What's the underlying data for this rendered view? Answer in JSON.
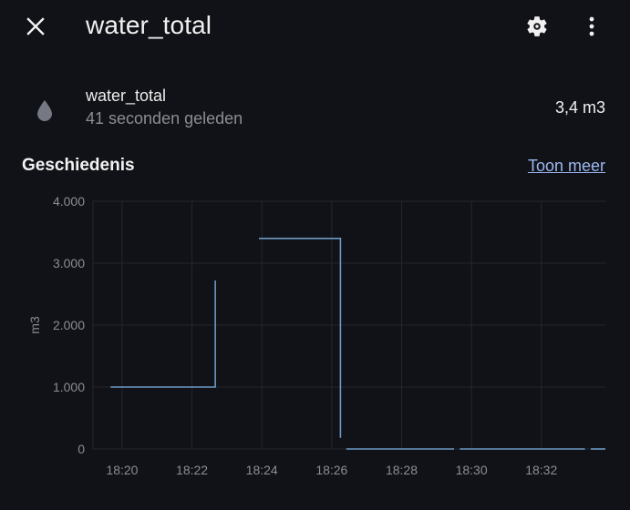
{
  "header": {
    "title": "water_total",
    "close_icon": "close-icon",
    "settings_icon": "gear-icon",
    "menu_icon": "dots-vertical-icon"
  },
  "entity": {
    "icon": "water-drop-icon",
    "name": "water_total",
    "last_changed": "41 seconden geleden",
    "state": "3,4 m3"
  },
  "history": {
    "title": "Geschiedenis",
    "show_more": "Toon meer"
  },
  "colors": {
    "background": "#111217",
    "accent_link": "#9ab8f0",
    "line": "#6e9ac4"
  },
  "chart_data": {
    "type": "line",
    "ylabel": "m3",
    "ylim": [
      0,
      4000
    ],
    "y_ticks": [
      "0",
      "1.000",
      "2.000",
      "3.000",
      "4.000"
    ],
    "x_ticks": [
      "18:20",
      "18:22",
      "18:24",
      "18:26",
      "18:28",
      "18:30",
      "18:32"
    ],
    "grid": true,
    "series": [
      {
        "segments": [
          [
            [
              "18:19:40",
              1000
            ],
            [
              "18:22:40",
              1000
            ],
            [
              "18:22:40",
              2720
            ]
          ],
          [
            [
              "18:23:55",
              3400
            ],
            [
              "18:26:15",
              3400
            ],
            [
              "18:26:15",
              180
            ]
          ],
          [
            [
              "18:26:25",
              0
            ],
            [
              "18:29:30",
              0
            ]
          ],
          [
            [
              "18:29:40",
              0
            ],
            [
              "18:33:15",
              0
            ]
          ],
          [
            [
              "18:33:25",
              0
            ],
            [
              "18:33:50",
              0
            ]
          ]
        ]
      }
    ]
  }
}
